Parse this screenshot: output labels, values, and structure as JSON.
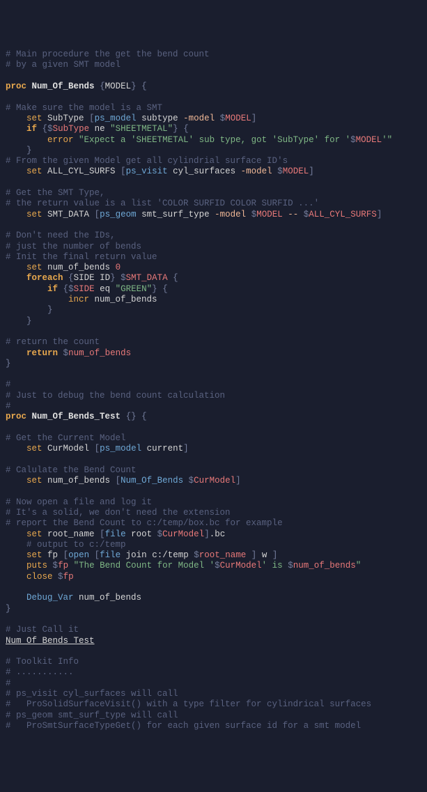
{
  "lines": [
    {
      "t": "comment",
      "c": "# Main procedure the get the bend count"
    },
    {
      "t": "comment",
      "c": "# by a given SMT model"
    },
    {
      "t": "blank",
      "c": ""
    },
    {
      "t": "proc_def",
      "kw": "proc",
      "name": "Num_Of_Bends",
      "args": "MODEL",
      "open": "{"
    },
    {
      "t": "blank",
      "c": ""
    },
    {
      "t": "comment",
      "c": "# Make sure the model is a SMT"
    },
    {
      "t": "set_brcmd",
      "indent": "    ",
      "var": "SubType",
      "func": "ps_model",
      "args": [
        {
          "k": "ident",
          "v": "subtype"
        },
        {
          "k": "flag",
          "v": "-model"
        },
        {
          "k": "var",
          "v": "MODEL"
        }
      ]
    },
    {
      "t": "if_open",
      "indent": "    ",
      "cond": [
        {
          "k": "var",
          "v": "SubType"
        },
        {
          "k": "ident",
          "v": "ne"
        },
        {
          "k": "string",
          "v": "\"SHEETMETAL\""
        }
      ]
    },
    {
      "t": "error",
      "indent": "        ",
      "pre": "\"Expect a 'SHEETMETAL' sub type, got 'SubType' for '",
      "var": "MODEL",
      "post": "'\""
    },
    {
      "t": "close_brace",
      "indent": "    "
    },
    {
      "t": "comment",
      "c": "# From the given Model get all cylindrial surface ID's"
    },
    {
      "t": "set_brcmd",
      "indent": "    ",
      "var": "ALL_CYL_SURFS",
      "func": "ps_visit",
      "args": [
        {
          "k": "ident",
          "v": "cyl_surfaces"
        },
        {
          "k": "flag",
          "v": "-model"
        },
        {
          "k": "var",
          "v": "MODEL"
        }
      ]
    },
    {
      "t": "blank",
      "c": ""
    },
    {
      "t": "comment",
      "c": "# Get the SMT Type,"
    },
    {
      "t": "comment",
      "c": "# the return value is a list 'COLOR SURFID COLOR SURFID ...'"
    },
    {
      "t": "set_brcmd",
      "indent": "    ",
      "var": "SMT_DATA",
      "func": "ps_geom",
      "args": [
        {
          "k": "ident",
          "v": "smt_surf_type"
        },
        {
          "k": "flag",
          "v": "-model"
        },
        {
          "k": "var",
          "v": "MODEL"
        },
        {
          "k": "flag",
          "v": "--"
        },
        {
          "k": "var",
          "v": "ALL_CYL_SURFS"
        }
      ]
    },
    {
      "t": "blank",
      "c": ""
    },
    {
      "t": "comment",
      "c": "# Don't need the IDs,"
    },
    {
      "t": "comment",
      "c": "# just the number of bends"
    },
    {
      "t": "comment",
      "c": "# Init the final return value"
    },
    {
      "t": "set_num",
      "indent": "    ",
      "var": "num_of_bends",
      "val": "0"
    },
    {
      "t": "foreach",
      "indent": "    ",
      "vars": "SIDE ID",
      "list": "SMT_DATA"
    },
    {
      "t": "if_open",
      "indent": "        ",
      "cond": [
        {
          "k": "var",
          "v": "SIDE"
        },
        {
          "k": "ident",
          "v": "eq"
        },
        {
          "k": "string",
          "v": "\"GREEN\""
        }
      ]
    },
    {
      "t": "incr",
      "indent": "            ",
      "var": "num_of_bends"
    },
    {
      "t": "close_brace",
      "indent": "        "
    },
    {
      "t": "close_brace",
      "indent": "    "
    },
    {
      "t": "blank",
      "c": ""
    },
    {
      "t": "comment",
      "c": "# return the count"
    },
    {
      "t": "return",
      "indent": "    ",
      "var": "num_of_bends"
    },
    {
      "t": "close_brace",
      "indent": ""
    },
    {
      "t": "blank",
      "c": ""
    },
    {
      "t": "comment",
      "c": "#"
    },
    {
      "t": "comment",
      "c": "# Just to debug the bend count calculation"
    },
    {
      "t": "comment",
      "c": "#"
    },
    {
      "t": "proc_def",
      "kw": "proc",
      "name": "Num_Of_Bends_Test",
      "args": "",
      "open": "{"
    },
    {
      "t": "blank",
      "c": ""
    },
    {
      "t": "comment",
      "c": "# Get the Current Model"
    },
    {
      "t": "set_brcmd",
      "indent": "    ",
      "var": "CurModel",
      "func": "ps_model",
      "args": [
        {
          "k": "ident",
          "v": "current"
        }
      ]
    },
    {
      "t": "blank",
      "c": ""
    },
    {
      "t": "comment",
      "c": "# Calulate the Bend Count"
    },
    {
      "t": "set_brcmd",
      "indent": "    ",
      "var": "num_of_bends",
      "func": "Num_Of_Bends",
      "args": [
        {
          "k": "var",
          "v": "CurModel"
        }
      ]
    },
    {
      "t": "blank",
      "c": ""
    },
    {
      "t": "comment",
      "c": "# Now open a file and log it"
    },
    {
      "t": "comment",
      "c": "# It's a solid, we don't need the extension"
    },
    {
      "t": "comment",
      "c": "# report the Bend Count to c:/temp/box.bc for example"
    },
    {
      "t": "set_rootname",
      "indent": "    ",
      "var": "root_name",
      "func": "file",
      "sub": "root",
      "arg": "CurModel",
      "suffix": ".bc"
    },
    {
      "t": "comment",
      "c": "    # output to c:/temp"
    },
    {
      "t": "set_open",
      "indent": "    ",
      "var": "fp",
      "func_outer": "open",
      "func_inner": "file",
      "sub": "join",
      "path": "c:/temp",
      "arg": "root_name",
      "mode": "w"
    },
    {
      "t": "puts",
      "indent": "    ",
      "chan": "fp",
      "pre": "\"The Bend Count for Model '",
      "var1": "CurModel",
      "mid": "' is ",
      "var2": "num_of_bends",
      "post": "\""
    },
    {
      "t": "close",
      "indent": "    ",
      "var": "fp"
    },
    {
      "t": "blank",
      "c": ""
    },
    {
      "t": "debug",
      "indent": "    ",
      "func": "Debug_Var",
      "arg": "num_of_bends"
    },
    {
      "t": "close_brace",
      "indent": ""
    },
    {
      "t": "blank",
      "c": ""
    },
    {
      "t": "comment",
      "c": "# Just Call it"
    },
    {
      "t": "plain_call",
      "c": "Num_Of_Bends_Test"
    },
    {
      "t": "blank",
      "c": ""
    },
    {
      "t": "comment",
      "c": "# Toolkit Info"
    },
    {
      "t": "comment",
      "c": "# ..........."
    },
    {
      "t": "comment",
      "c": "#"
    },
    {
      "t": "comment",
      "c": "# ps_visit cyl_surfaces will call "
    },
    {
      "t": "comment",
      "c": "#   ProSolidSurfaceVisit() with a type filter for cylindrical surfaces"
    },
    {
      "t": "comment",
      "c": "# ps_geom smt_surf_type will call"
    },
    {
      "t": "comment",
      "c": "#   ProSmtSurfaceTypeGet() for each given surface id for a smt model"
    }
  ]
}
